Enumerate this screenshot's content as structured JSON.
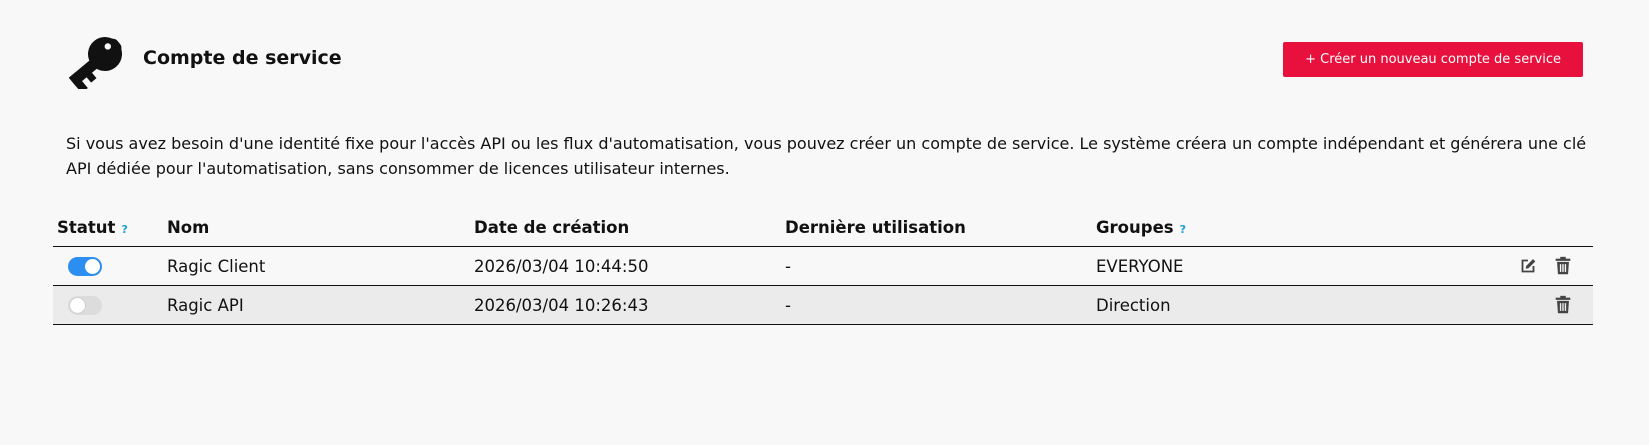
{
  "header": {
    "icon": "key-icon",
    "title": "Compte de service",
    "create_button": "+ Créer un nouveau compte de service"
  },
  "description": "Si vous avez besoin d'une identité fixe pour l'accès API ou les flux d'automatisation, vous pouvez créer un compte de service. Le système créera un compte indépendant et générera une clé API dédiée pour l'automatisation, sans consommer de licences utilisateur internes.",
  "table": {
    "columns": {
      "status": "Statut",
      "name": "Nom",
      "created": "Date de création",
      "last_used": "Dernière utilisation",
      "groups": "Groupes"
    },
    "help_glyph": "?",
    "rows": [
      {
        "enabled": true,
        "name": "Ragic Client",
        "created": "2026/03/04 10:44:50",
        "last_used": "-",
        "groups": "EVERYONE",
        "actions": [
          "edit-icon",
          "trash-icon"
        ]
      },
      {
        "enabled": false,
        "name": "Ragic API",
        "created": "2026/03/04 10:26:43",
        "last_used": "-",
        "groups": "Direction",
        "actions": [
          "trash-icon"
        ]
      }
    ]
  },
  "colors": {
    "accent_button": "#e8113d",
    "toggle_on": "#2d8ef2",
    "help_icon": "#1a9fd6",
    "background": "#f8f8f8"
  }
}
